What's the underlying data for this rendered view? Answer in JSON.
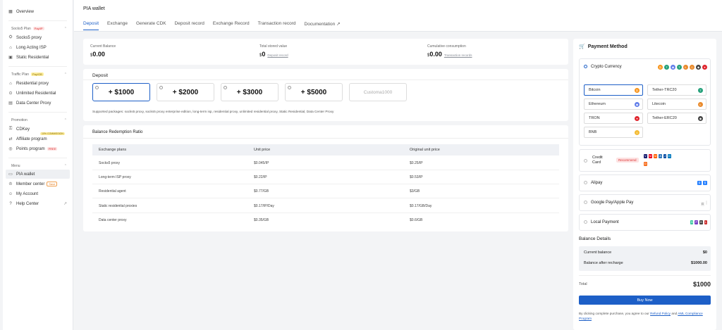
{
  "sidebar": {
    "overview": "Overview",
    "groups": [
      {
        "label": "Socks5 Plan",
        "tag": "Pay/IP",
        "items": [
          "Socks5 proxy",
          "Long Acting ISP",
          "Static Residential"
        ]
      },
      {
        "label": "Traffic Plan",
        "tag": "Pay/GB",
        "items": [
          "Residential proxy",
          "Unlimited Residential",
          "Data Center Proxy"
        ]
      },
      {
        "label": "Promotion",
        "items": [
          "CDKey",
          "Affiliate program",
          "Points program"
        ],
        "affiliate_tag": "10% COMMISSION",
        "points_tag": "FREE"
      },
      {
        "label": "Menu",
        "items": [
          "PIA wallet",
          "Member center",
          "My Account",
          "Help Center"
        ],
        "member_tag": "Save"
      }
    ]
  },
  "header": {
    "title": "PIA wallet",
    "tabs": [
      "Deposit",
      "Exchange",
      "Generate CDK",
      "Deposit record",
      "Exchange Record",
      "Transaction record",
      "Documentation"
    ]
  },
  "balances": {
    "current_label": "Current Balance",
    "current_value": "0.00",
    "stored_label": "Total stored value",
    "stored_value": "0",
    "stored_link": "Deposit record",
    "consumption_label": "Cumulative consumption",
    "consumption_value": "0.00",
    "consumption_link": "Transaction records",
    "currency": "$"
  },
  "deposit": {
    "title": "Deposit",
    "amounts": [
      "+ $1000",
      "+ $2000",
      "+ $3000",
      "+ $5000"
    ],
    "custom_placeholder": "Customa1000",
    "supported": "Supported packages: socks5 proxy, socks5 proxy enterprise edition, long-term isp, residential proxy, unlimited residential proxy, Static Residential, Data Center Proxy"
  },
  "ratio": {
    "title": "Balance Redemption Ratio",
    "columns": [
      "Exchange plans",
      "Unit price",
      "Original unit price"
    ],
    "rows": [
      [
        "Socks5 proxy",
        "$0.045/IP",
        "$0.25/IP"
      ],
      [
        "Long-term ISP proxy",
        "$0.22/IP",
        "$0.53/IP"
      ],
      [
        "Residential agent",
        "$0.77/GB",
        "$3/GB"
      ],
      [
        "Static residential proxies",
        "$0.17/IP/Day",
        "$0.17/GB/Day"
      ],
      [
        "Data center proxy",
        "$0.35/GB",
        "$0.6/GB"
      ]
    ]
  },
  "payment": {
    "title": "Payment Method",
    "crypto_label": "Crypto Currency",
    "coins": [
      "Bitcoin",
      "Tether-TRC20",
      "Ethereum",
      "Litecoin",
      "TRON",
      "Tether-ERC20",
      "BNB"
    ],
    "credit_label": "Credit Card",
    "recommend": "Recommend",
    "alipay": "Alipay",
    "google_apple": "Google Pay/Apple Pay",
    "local": "Local Payment",
    "colors": {
      "accent": "#1d5fc7",
      "btc": "#f7931a",
      "tether": "#26a17b",
      "eth": "#627eea",
      "ltc": "#e98a2b",
      "tron": "#e0262f",
      "bnb": "#f3ba2f"
    }
  },
  "balance_details": {
    "title": "Balance Details",
    "current_label": "Current balance",
    "current_value": "$0",
    "after_label": "Balance after recharge",
    "after_value": "$1000.00",
    "total_label": "Total",
    "total_value": "$1000",
    "buy_label": "Buy Now",
    "terms_prefix": "By clicking complete purchase, you agree to our",
    "refund": "Refund Policy",
    "and": "and",
    "aml": "AML Compliance Program"
  }
}
